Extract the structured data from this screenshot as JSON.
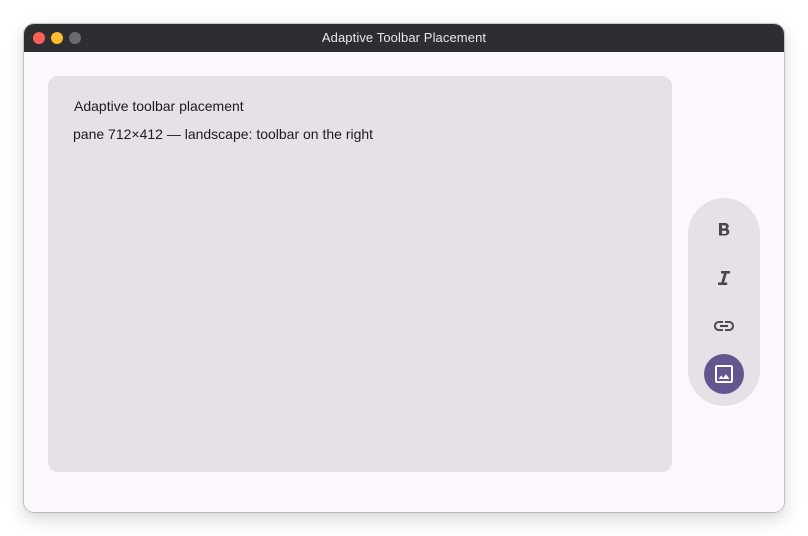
{
  "window": {
    "title": "Adaptive Toolbar Placement"
  },
  "pane": {
    "title": "Adaptive toolbar placement",
    "info": "pane 712×412 — landscape: toolbar on the right"
  },
  "toolbar": {
    "orientation": "vertical",
    "placement": "right",
    "items": [
      {
        "icon": "bold-icon",
        "selected": false
      },
      {
        "icon": "italic-icon",
        "selected": false
      },
      {
        "icon": "link-icon",
        "selected": false
      },
      {
        "icon": "image-icon",
        "selected": true
      }
    ]
  },
  "colors": {
    "titlebar": "#2e2d31",
    "window_background": "#fcf7fc",
    "pane_background": "#e6e0e7",
    "icon": "#49454f",
    "selected_background": "#64558f",
    "selected_icon": "#ffffff"
  }
}
